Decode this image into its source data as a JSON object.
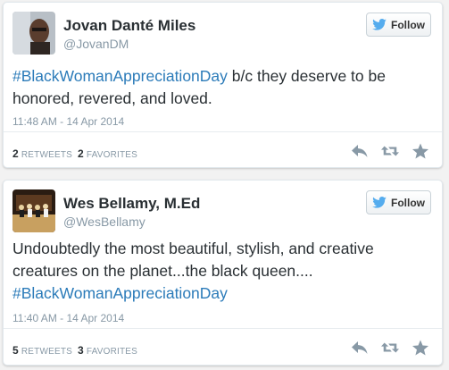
{
  "tweets": [
    {
      "author_name": "Jovan Danté Miles",
      "handle": "@JovanDM",
      "follow_label": "Follow",
      "hashtag": "#BlackWomanAppreciationDay",
      "text_after": " b/c they deserve to be honored, revered, and loved.",
      "timestamp": "11:48 AM - 14 Apr 2014",
      "retweets_count": "2",
      "retweets_label": "RETWEETS",
      "favorites_count": "2",
      "favorites_label": "FAVORITES",
      "icons": [
        "reply-icon",
        "retweet-icon",
        "favorite-icon"
      ]
    },
    {
      "author_name": "Wes Bellamy, M.Ed",
      "handle": "@WesBellamy",
      "follow_label": "Follow",
      "text_before": "Undoubtedly the most beautiful, stylish, and creative creatures on the planet...the black queen.... ",
      "hashtag": "#BlackWomanAppreciationDay",
      "timestamp": "11:40 AM - 14 Apr 2014",
      "retweets_count": "5",
      "retweets_label": "RETWEETS",
      "favorites_count": "3",
      "favorites_label": "FAVORITES",
      "icons": [
        "reply-icon",
        "retweet-icon",
        "favorite-icon"
      ]
    }
  ],
  "colors": {
    "link": "#2b7bb9",
    "twitter_bird": "#55acee",
    "muted": "#8899a6",
    "text": "#292f33",
    "action_icon": "#8899a6"
  }
}
